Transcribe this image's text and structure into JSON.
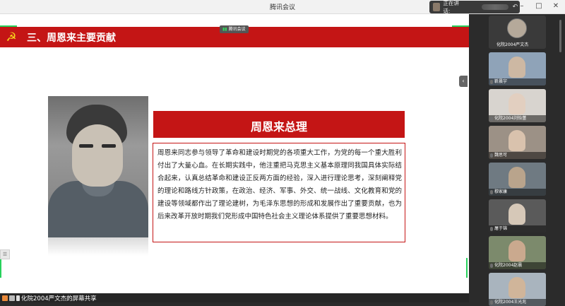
{
  "window": {
    "title": "腾讯会议"
  },
  "speaking": {
    "label": "正在讲话:"
  },
  "float_badge": "腾讯会议",
  "slide": {
    "section_title": "三、周恩来主要贡献",
    "name_title": "周恩来总理",
    "body": "周恩来同志参与领导了革命和建设时期党的各项重大工作，为党的每一个重大胜利付出了大量心血。在长期实践中，他注重把马克思主义基本原理同我国具体实际结合起来，认真总结革命和建设正反两方面的经验，深入进行理论思考，深刻阐释党的理论和路线方针政策，在政治、经济、军事、外交、统一战线、文化教育和党的建设等领域都作出了理论建树，为毛泽东思想的形成和发展作出了重要贡献，也为后来改革开放时期我们党形成中国特色社会主义理论体系提供了重要思想材料。"
  },
  "bottom_bar": {
    "share_label": "化院2004严文杰的屏幕共享"
  },
  "participants": [
    {
      "name": "化院2004严文杰",
      "kind": "avatar"
    },
    {
      "name": "靳晨宇",
      "kind": "video",
      "bg": "#8fa3b8",
      "person": "#cdb8a3"
    },
    {
      "name": "化院2004刘怡蕾",
      "kind": "video",
      "bg": "#d8d4cf",
      "person": "#e2cfc0"
    },
    {
      "name": "魏思可",
      "kind": "video",
      "bg": "#9c9186",
      "person": "#d9c2ad"
    },
    {
      "name": "穆家康",
      "kind": "video",
      "bg": "#6f7a82",
      "person": "#b9a48c"
    },
    {
      "name": "屠于锦",
      "kind": "video",
      "bg": "#5a5a5a",
      "person": "#d6c8b8"
    },
    {
      "name": "化院2004赵晨",
      "kind": "video",
      "bg": "#7c8a6c",
      "person": "#caa98e"
    },
    {
      "name": "化院2004王光兆",
      "kind": "video",
      "bg": "#a9b4be",
      "person": "#d0b59a"
    }
  ],
  "colors": {
    "slide_red": "#c41515",
    "share_green": "#27d15c",
    "emblem_gold": "#f7d21b"
  }
}
